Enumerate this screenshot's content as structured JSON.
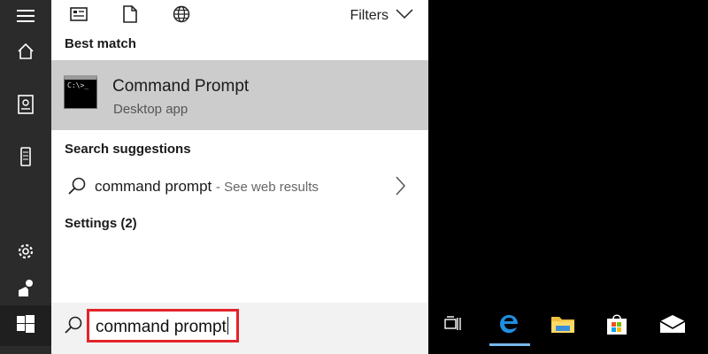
{
  "rail": {
    "items": [
      {
        "name": "hamburger-menu-icon"
      },
      {
        "name": "home-icon"
      },
      {
        "name": "notebook-icon"
      },
      {
        "name": "device-icon"
      },
      {
        "name": "settings-gear-icon"
      },
      {
        "name": "feedback-icon"
      },
      {
        "name": "windows-start-icon"
      }
    ]
  },
  "topbar": {
    "icons": [
      "apps-icon",
      "documents-icon",
      "web-icon"
    ],
    "filters_label": "Filters"
  },
  "best_match": {
    "heading": "Best match",
    "title": "Command Prompt",
    "subtitle": "Desktop app",
    "icon_text": "C:\\>_"
  },
  "suggestions": {
    "heading": "Search suggestions",
    "items": [
      {
        "query": "command prompt",
        "suffix": "- See web results"
      }
    ]
  },
  "settings": {
    "heading": "Settings (2)"
  },
  "search": {
    "value": "command prompt"
  },
  "taskbar": {
    "items": [
      "task-view-icon",
      "edge-icon",
      "file-explorer-icon",
      "store-icon",
      "mail-icon"
    ],
    "accent_color": "#76b9ed"
  },
  "colors": {
    "rail_bg": "#2b2b2b",
    "highlight_bg": "#cccccc",
    "search_outline": "#e3242b"
  }
}
